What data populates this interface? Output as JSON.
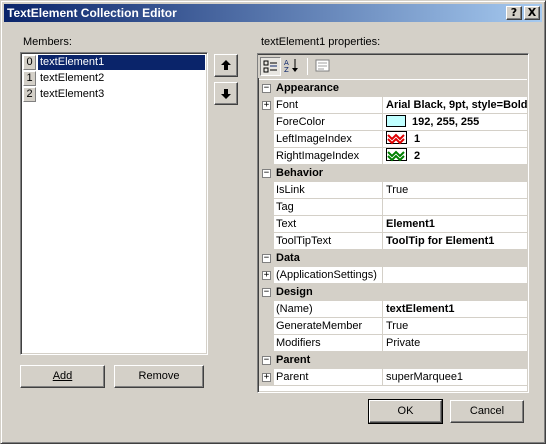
{
  "window": {
    "title": "TextElement Collection Editor",
    "help_button": "?",
    "close_button": "X"
  },
  "members": {
    "label": "Members:",
    "items": [
      {
        "index": "0",
        "name": "textElement1",
        "selected": true
      },
      {
        "index": "1",
        "name": "textElement2",
        "selected": false
      },
      {
        "index": "2",
        "name": "textElement3",
        "selected": false
      }
    ],
    "move_up_icon": "arrow-up-icon",
    "move_down_icon": "arrow-down-icon",
    "add_label": "Add",
    "remove_label": "Remove"
  },
  "properties": {
    "label": "textElement1 properties:",
    "toolbar_icons": [
      "categorized-icon",
      "alphabetical-icon",
      "property-pages-icon"
    ],
    "categories": [
      {
        "name": "Appearance",
        "rows": [
          {
            "name": "Font",
            "value": "Arial Black, 9pt, style=Bold",
            "bold": true,
            "expandable": true
          },
          {
            "name": "ForeColor",
            "value": "192, 255, 255",
            "bold": true,
            "swatch": "#c0ffff"
          },
          {
            "name": "LeftImageIndex",
            "value": "1",
            "bold": true,
            "swatch_icon": "red-zigzag-icon"
          },
          {
            "name": "RightImageIndex",
            "value": "2",
            "bold": true,
            "swatch_icon": "green-zigzag-icon"
          }
        ]
      },
      {
        "name": "Behavior",
        "rows": [
          {
            "name": "IsLink",
            "value": "True",
            "bold": false
          },
          {
            "name": "Tag",
            "value": "",
            "bold": false
          },
          {
            "name": "Text",
            "value": "Element1",
            "bold": true
          },
          {
            "name": "ToolTipText",
            "value": "ToolTip for Element1",
            "bold": true
          }
        ]
      },
      {
        "name": "Data",
        "rows": [
          {
            "name": "(ApplicationSettings)",
            "value": "",
            "bold": false,
            "expandable": true
          }
        ]
      },
      {
        "name": "Design",
        "rows": [
          {
            "name": "(Name)",
            "value": "textElement1",
            "bold": true
          },
          {
            "name": "GenerateMember",
            "value": "True",
            "bold": false
          },
          {
            "name": "Modifiers",
            "value": "Private",
            "bold": false
          }
        ]
      },
      {
        "name": "Parent",
        "rows": [
          {
            "name": "Parent",
            "value": "superMarquee1",
            "bold": false,
            "expandable": true
          }
        ]
      }
    ]
  },
  "footer": {
    "ok_label": "OK",
    "cancel_label": "Cancel"
  },
  "colors": {
    "title_start": "#0a246a",
    "title_end": "#a6caf0",
    "face": "#d4d0c8",
    "selection": "#0a246a"
  }
}
